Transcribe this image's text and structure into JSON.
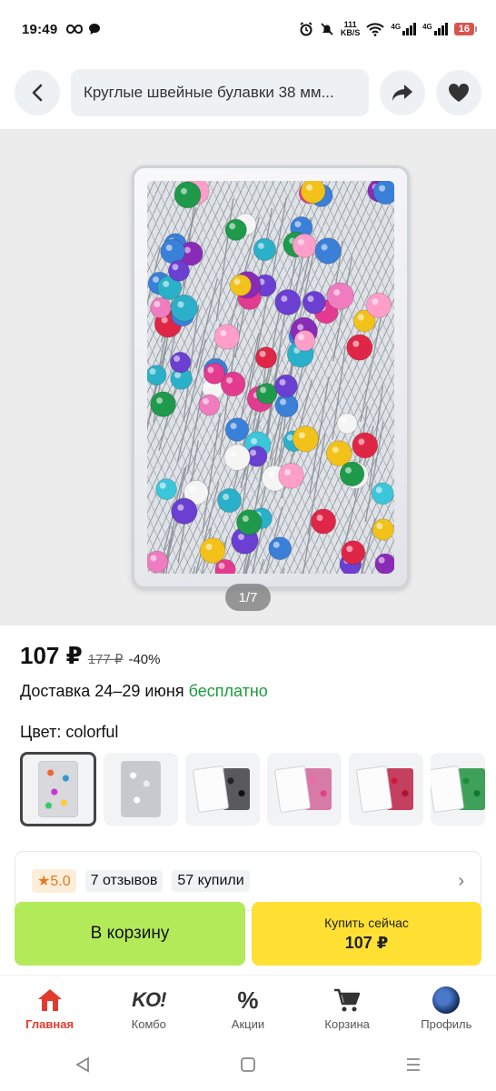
{
  "status_bar": {
    "time": "19:49",
    "net_speed_value": "111",
    "net_speed_unit": "KB/S",
    "signal_1": "4G",
    "signal_2": "4G",
    "battery": "16"
  },
  "top_bar": {
    "back_icon": "chevron-left-icon",
    "search_text": "Круглые швейные булавки 38 мм...",
    "share_icon": "share-icon",
    "favorite_icon": "heart-icon"
  },
  "gallery": {
    "counter": "1/7"
  },
  "product": {
    "price": "107 ₽",
    "old_price": "177 ₽",
    "discount": "-40%",
    "delivery_prefix": "Доставка 24–29 июня",
    "delivery_free": "бесплатно",
    "color_label": "Цвет: colorful",
    "variants_count_shown": 6
  },
  "rating": {
    "score": "5.0",
    "reviews": "7 отзывов",
    "bought": "57 купили"
  },
  "actions": {
    "add_to_cart": "В корзину",
    "buy_now": "Купить сейчас",
    "buy_now_price": "107 ₽"
  },
  "bottom_nav": [
    {
      "label": "Главная",
      "icon": "home-icon",
      "active": true
    },
    {
      "label": "Комбо",
      "icon": "ko-icon",
      "icon_text": "KO!",
      "active": false
    },
    {
      "label": "Акции",
      "icon": "percent-icon",
      "icon_text": "%",
      "active": false
    },
    {
      "label": "Корзина",
      "icon": "cart-icon",
      "active": false
    },
    {
      "label": "Профиль",
      "icon": "avatar-icon",
      "active": false
    }
  ],
  "colors": {
    "accent_red": "#e23b2e",
    "cart_green": "#b3ea5a",
    "buy_yellow": "#ffe033",
    "free_green": "#1c9b3e"
  }
}
